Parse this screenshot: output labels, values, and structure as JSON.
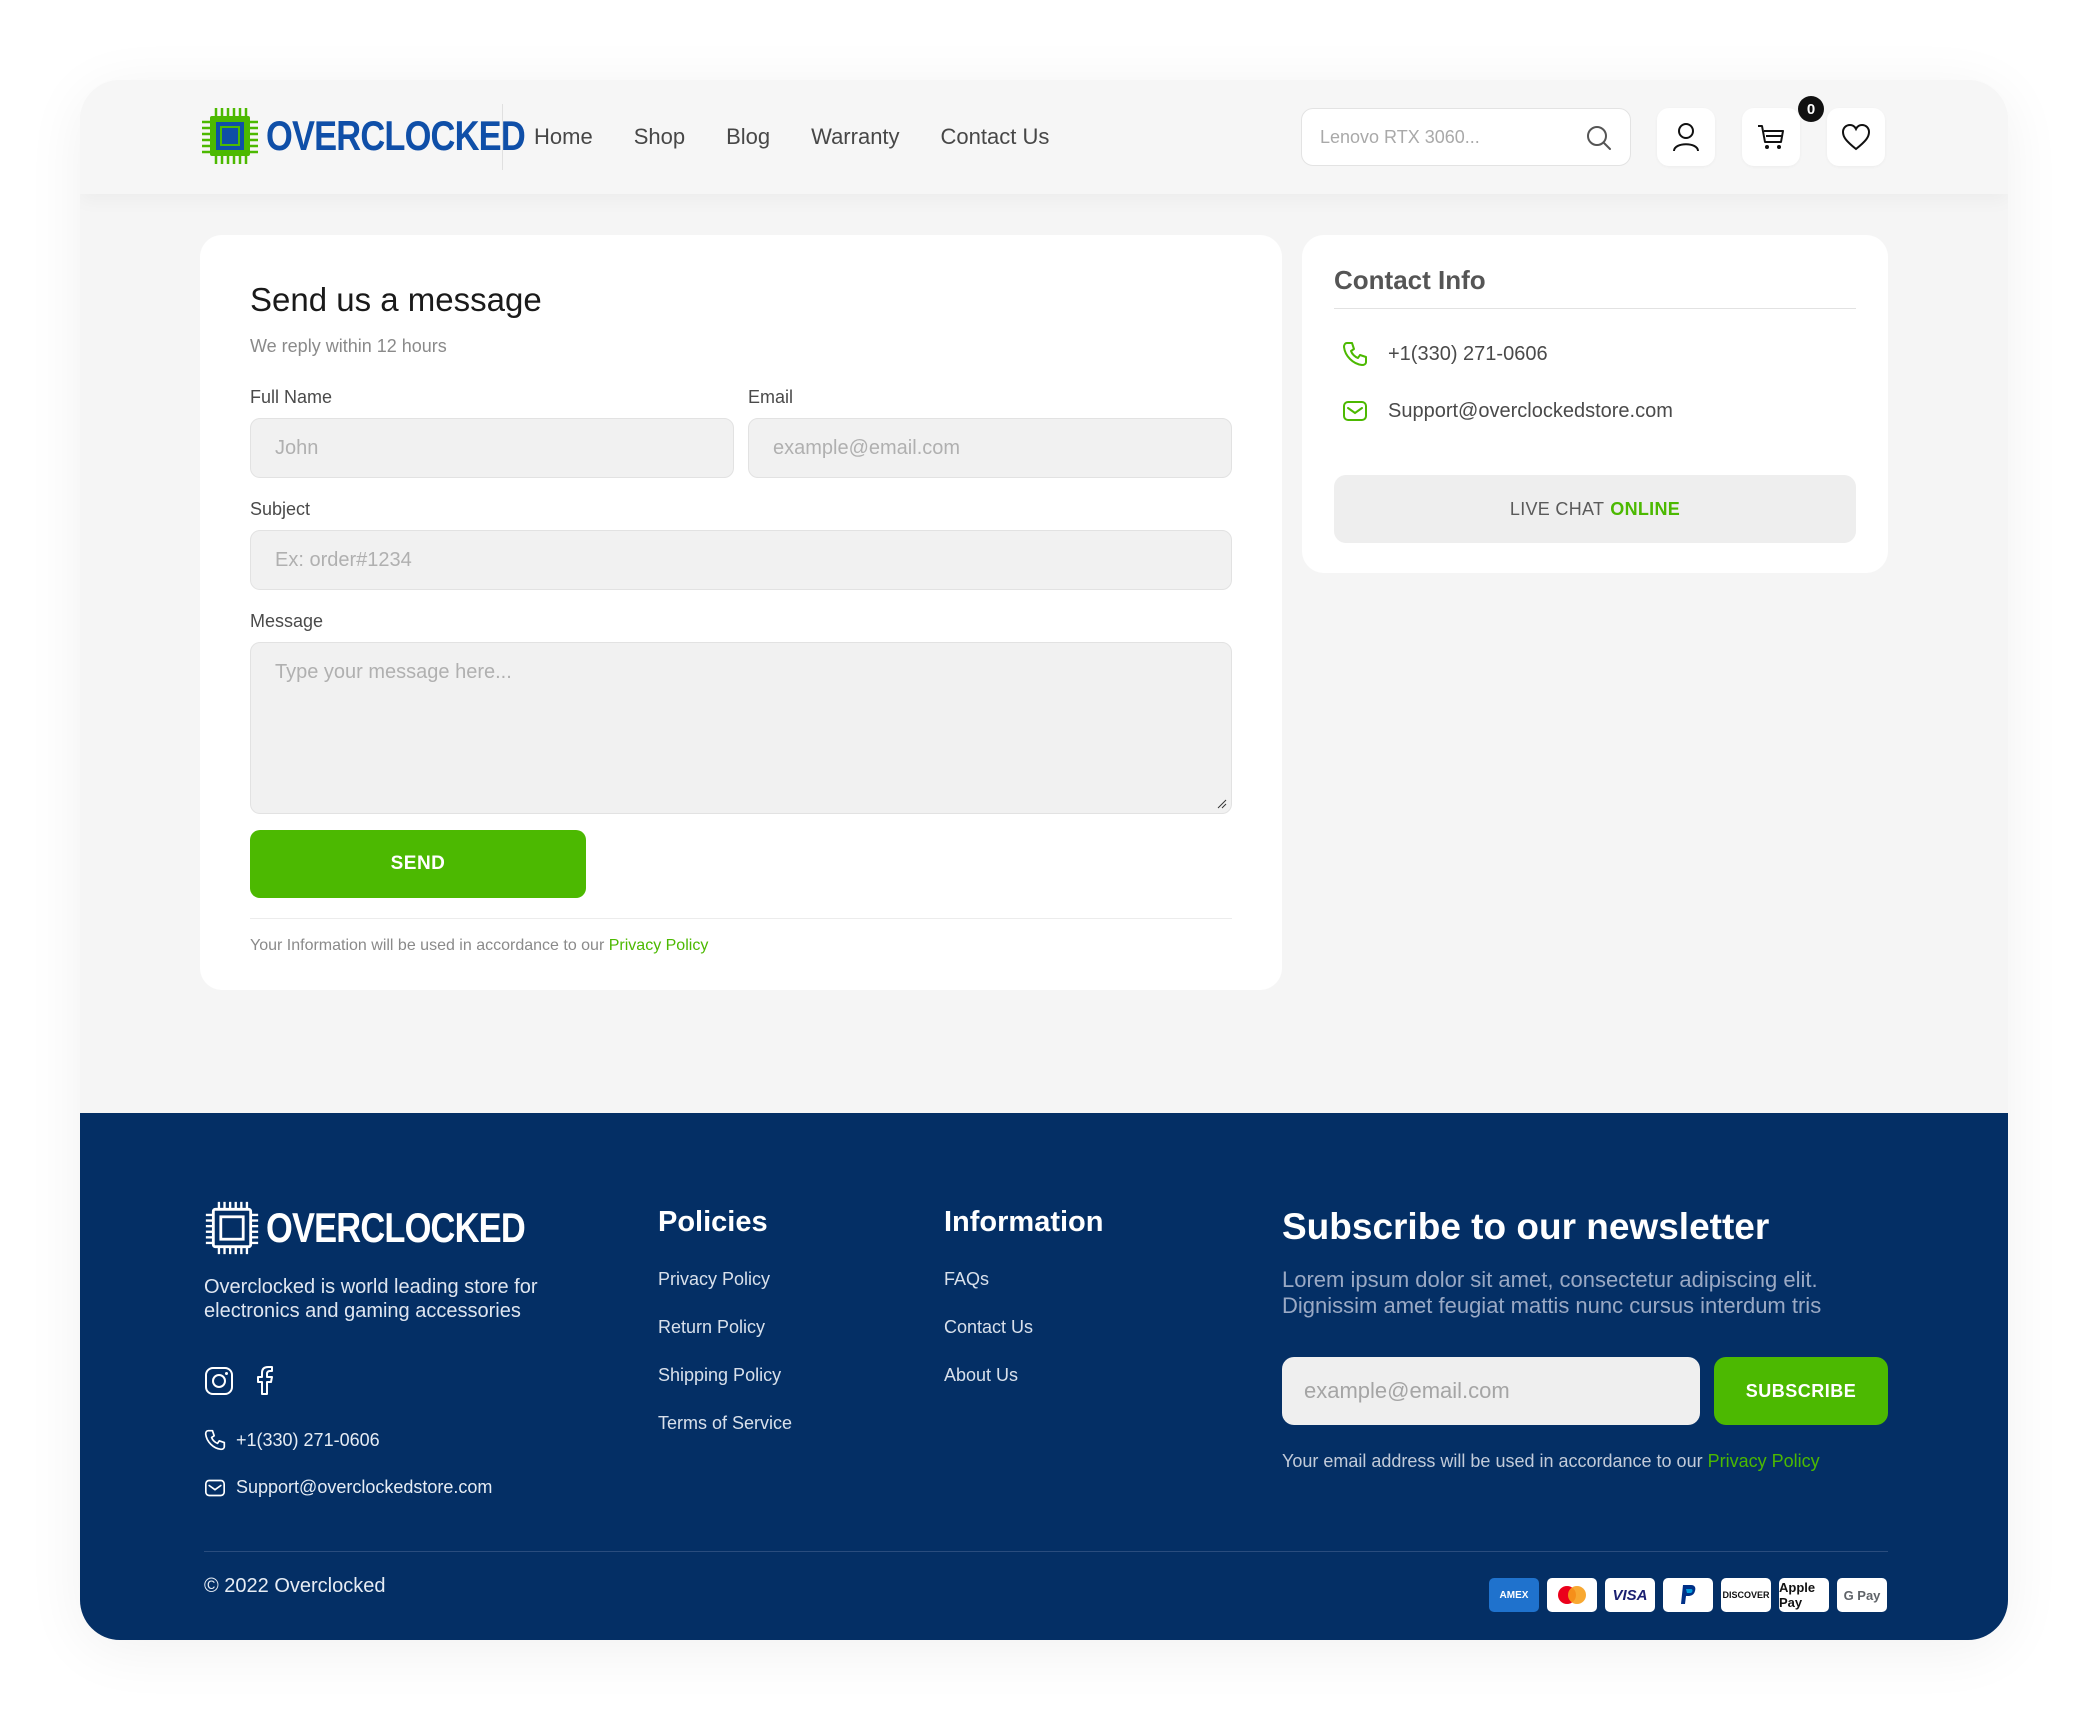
{
  "header": {
    "logo_text": "OVERCLOCKED",
    "nav": [
      "Home",
      "Shop",
      "Blog",
      "Warranty",
      "Contact Us"
    ],
    "search_placeholder": "Lenovo RTX 3060...",
    "cart_count": "0"
  },
  "form": {
    "title": "Send us a message",
    "subtitle": "We reply within 12 hours",
    "full_name_label": "Full Name",
    "full_name_placeholder": "John",
    "email_label": "Email",
    "email_placeholder": "example@email.com",
    "subject_label": "Subject",
    "subject_placeholder": "Ex: order#1234",
    "message_label": "Message",
    "message_placeholder": "Type your message here...",
    "send_label": "SEND",
    "note_prefix": "Your Information will be used in accordance to our",
    "note_link": "Privacy Policy"
  },
  "contact_info": {
    "title": "Contact Info",
    "phone": "+1(330) 271-0606",
    "email": "Support@overclockedstore.com",
    "chat_prefix": "LIVE CHAT",
    "chat_status": "ONLINE"
  },
  "footer": {
    "logo_text": "OVERCLOCKED",
    "description": "Overclocked is world leading store for electronics and gaming accessories",
    "phone": "+1(330) 271-0606",
    "email": "Support@overclockedstore.com",
    "policies_title": "Policies",
    "policies": [
      "Privacy Policy",
      "Return Policy",
      "Shipping Policy",
      "Terms of Service"
    ],
    "information_title": "Information",
    "information": [
      "FAQs",
      "Contact Us",
      "About Us"
    ],
    "newsletter_title": "Subscribe to our newsletter",
    "newsletter_desc": "Lorem ipsum dolor sit amet, consectetur adipiscing elit. Dignissim amet feugiat mattis nunc cursus interdum tris",
    "newsletter_placeholder": "example@email.com",
    "subscribe_label": "SUBSCRIBE",
    "newsletter_note_prefix": "Your email address will be used in accordance to our",
    "newsletter_note_link": "Privacy Policy",
    "copyright": "© 2022 Overclocked",
    "payment_methods": [
      "AMEX",
      "Mastercard",
      "VISA",
      "PayPal",
      "DISCOVER",
      "Apple Pay",
      "G Pay"
    ]
  },
  "colors": {
    "brand_blue": "#0f4fa8",
    "accent_green": "#4cb901",
    "footer_bg": "#042f65"
  }
}
